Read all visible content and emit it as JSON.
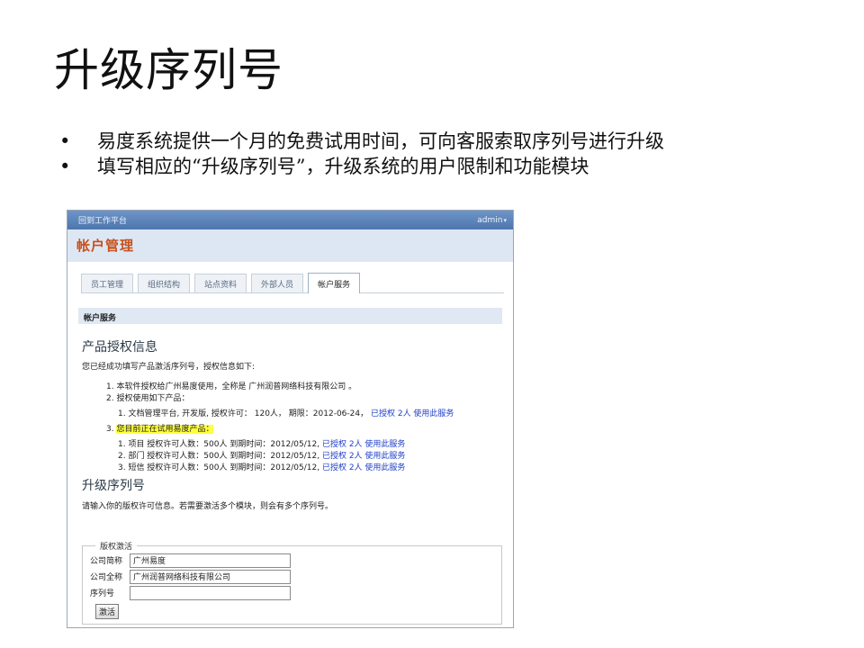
{
  "slide": {
    "title": "升级序列号",
    "bullets": [
      "易度系统提供一个月的免费试用时间，可向客服索取序列号进行升级",
      "填写相应的“升级序列号”，升级系统的用户限制和功能模块"
    ],
    "bullet_glyph": "•"
  },
  "app": {
    "topbar": {
      "back_link": "回到工作平台",
      "user_menu": "admin",
      "user_caret": "▾"
    },
    "page_title": "帐户管理",
    "tabs": [
      {
        "label": "员工管理",
        "active": false
      },
      {
        "label": "组织结构",
        "active": false
      },
      {
        "label": "站点资料",
        "active": false
      },
      {
        "label": "外部人员",
        "active": false
      },
      {
        "label": "帐户服务",
        "active": true
      }
    ],
    "section_title": "帐户服务",
    "license": {
      "heading": "产品授权信息",
      "intro": "您已经成功填写产品激活序列号，授权信息如下:",
      "item1": "1. 本软件授权给广州易度使用，全称是 广州润普网络科技有限公司 。",
      "item2": "2. 授权使用如下产品：",
      "product1_text": "1. 文档管理平台, 开发版, 授权许可： 120人， 期限：2012-06-24，",
      "product1_link": "已授权 2人 使用此服务",
      "item3_prefix": "3. ",
      "item3_highlight": "您目前正在试用易度产品：",
      "trials": [
        {
          "text": "1. 项目 授权许可人数：500人 到期时间：2012/05/12,",
          "link": "已授权 2人 使用此服务"
        },
        {
          "text": "2. 部门 授权许可人数：500人 到期时间：2012/05/12,",
          "link": "已授权 2人 使用此服务"
        },
        {
          "text": "3. 短信 授权许可人数：500人 到期时间：2012/05/12,",
          "link": "已授权 2人 使用此服务"
        }
      ]
    },
    "upgrade": {
      "heading": "升级序列号",
      "intro": "请输入你的版权许可信息。若需要激活多个模块，则会有多个序列号。",
      "legend": "版权激活",
      "fields": [
        {
          "label": "公司简称",
          "value": "广州易度"
        },
        {
          "label": "公司全称",
          "value": "广州润普网络科技有限公司"
        },
        {
          "label": "序列号",
          "value": ""
        }
      ],
      "submit_label": "激活"
    }
  }
}
